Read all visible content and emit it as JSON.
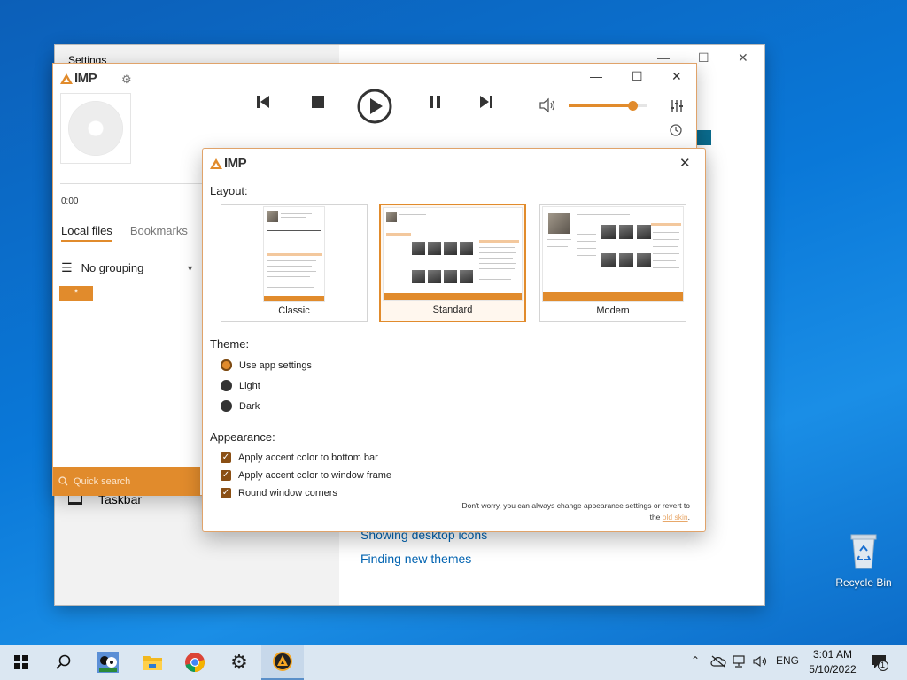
{
  "desktop": {
    "recycle_bin_label": "Recycle Bin"
  },
  "settings_window": {
    "title": "Settings",
    "taskbar_label": "Taskbar",
    "links": [
      "Showing desktop icons",
      "Finding new themes"
    ]
  },
  "aimp": {
    "logo_text": "IMP",
    "time": "0:00",
    "tabs": [
      {
        "label": "Local files"
      },
      {
        "label": "Bookmarks"
      }
    ],
    "grouping_label": "No grouping",
    "filter_tag": "*",
    "search_placeholder": "Quick search",
    "volume_level": 0.82
  },
  "dialog": {
    "logo_text": "IMP",
    "layout_label": "Layout:",
    "layouts": [
      {
        "label": "Classic"
      },
      {
        "label": "Standard"
      },
      {
        "label": "Modern"
      }
    ],
    "selected_layout": "Standard",
    "theme_label": "Theme:",
    "themes": [
      {
        "label": "Use app settings"
      },
      {
        "label": "Light"
      },
      {
        "label": "Dark"
      }
    ],
    "selected_theme": "Use app settings",
    "appearance_label": "Appearance:",
    "appearance_options": [
      {
        "label": "Apply accent color to bottom bar",
        "checked": true
      },
      {
        "label": "Apply accent color to window frame",
        "checked": true
      },
      {
        "label": "Round window corners",
        "checked": true
      }
    ],
    "note_text": "Don't worry, you can always change appearance settings or revert to",
    "note_the": "the",
    "note_link": "old skin",
    "note_end": "."
  },
  "taskbar": {
    "language": "ENG",
    "time": "3:01 AM",
    "date": "5/10/2022",
    "notification_count": "1"
  },
  "colors": {
    "accent": "#e18b2c",
    "desktop": "#0a78d8"
  },
  "icons": {
    "transport": [
      "previous-icon",
      "stop-icon",
      "play-icon",
      "pause-icon",
      "next-icon"
    ],
    "taskbar": [
      "windows-start-icon",
      "search-icon",
      "app-icon",
      "file-explorer-icon",
      "chrome-icon",
      "settings-icon",
      "aimp-icon"
    ]
  }
}
